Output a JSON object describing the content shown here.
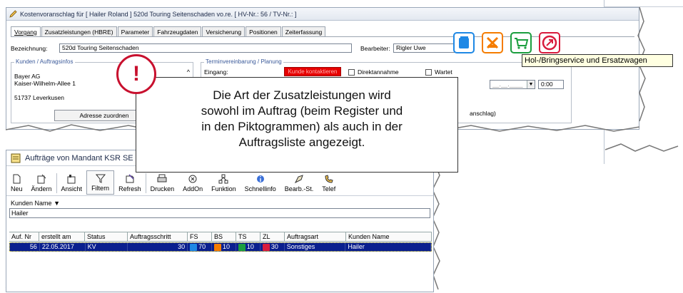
{
  "top_window": {
    "title": "Kostenvoranschlag  für [ Hailer Roland ] 520d Touring Seitenschaden vo.re. [ HV-Nr.: 56 / TV-Nr.: ]",
    "tabs": [
      "Vorgang",
      "Zusatzleistungen (HBRE)",
      "Parameter",
      "Fahrzeugdaten",
      "Versicherung",
      "Positionen",
      "Zeiterfassung"
    ],
    "bezeichnung_label": "Bezeichnung:",
    "bezeichnung_value": "520d Touring Seitenschaden",
    "bearbeiter_label": "Bearbeiter:",
    "bearbeiter_value": "Rigler Uwe",
    "kunden_group_title": "Kunden / Auftragsinfos",
    "address_lines": [
      "Bayer AG",
      "Kaiser-Wilhelm-Allee 1",
      "",
      "51737 Leverkusen"
    ],
    "adresse_button": "Adresse zuordnen",
    "termin_group_title": "Terminvereinbarung / Planung",
    "eingang_label": "Eingang:",
    "kunde_kontaktieren": "Kunde kontaktieren",
    "direktannahme": "Direktannahme",
    "wartet": "Wartet",
    "date_value": "__.__.____",
    "time_value": "0:00",
    "fragment_text": "anschlag)"
  },
  "tooltip": "Hol-/Bringservice und Ersatzwagen",
  "pictograms": [
    {
      "name": "fs-icon",
      "color": "#1e88e5"
    },
    {
      "name": "bs-icon",
      "color": "#f57c00"
    },
    {
      "name": "ts-icon",
      "color": "#1b9e3e"
    },
    {
      "name": "zl-icon",
      "color": "#d81b3c"
    }
  ],
  "callout": {
    "lines": [
      "Die Art der Zusatzleistungen wird",
      "sowohl im Auftrag (beim Register und",
      "in den Piktogrammen) als auch in der",
      "Auftragsliste angezeigt."
    ],
    "mark": "!"
  },
  "bottom_window": {
    "title": "Aufträge von Mandant  KSR SE",
    "toolbar": [
      "Neu",
      "Ändern",
      "Ansicht",
      "Filtern",
      "Refresh",
      "Drucken",
      "AddOn",
      "Funktion",
      "Schnellinfo",
      "Bearb.-St.",
      "Telef"
    ],
    "filter_label": "Kunden Name",
    "filter_value": "Hailer",
    "columns": [
      "Auf. Nr",
      "erstellt am",
      "Status",
      "Auftragsschritt",
      "FS",
      "BS",
      "TS",
      "ZL",
      "Auftragsart",
      "Kunden Name"
    ],
    "row": {
      "auf_nr": "56",
      "erstellt_am": "22.05.2017",
      "status": "KV",
      "auftragsschritt": "30",
      "fs": "70",
      "bs": "10",
      "ts": "10",
      "zl": "30",
      "auftragsart": "Sonstiges",
      "kunden_name": "Hailer"
    }
  }
}
